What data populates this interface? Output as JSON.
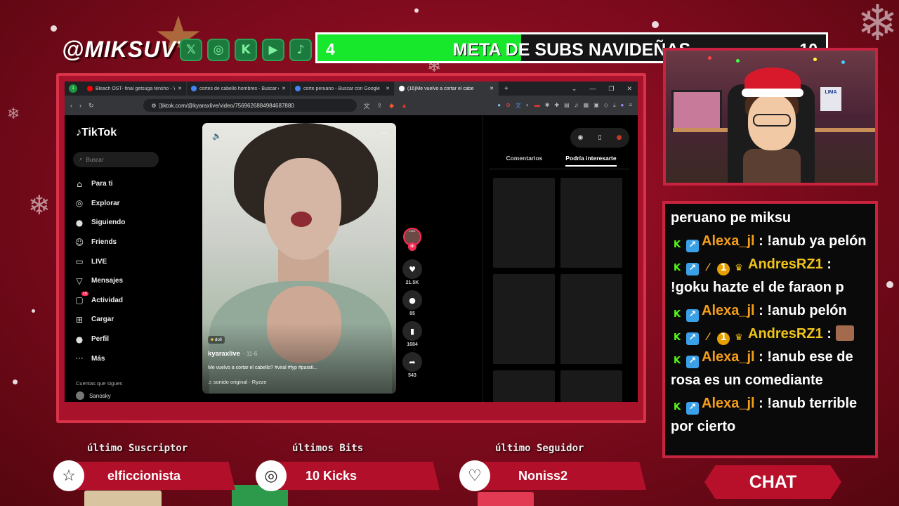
{
  "streamer_handle": "@MIKSUVT",
  "social_icons": [
    "x-icon",
    "instagram-icon",
    "kick-icon",
    "youtube-icon",
    "tiktok-icon"
  ],
  "subs_goal": {
    "current": "4",
    "title": "META DE SUBS NAVIDEÑAS",
    "target": "10",
    "progress_fraction": 0.4
  },
  "browser": {
    "tabs": [
      {
        "title": "Bleach OST- final getsuga tensho - Yo",
        "favicon_color": "#ff0000"
      },
      {
        "title": "cortes de cabello hombres - Buscar c",
        "favicon_color": "#4285f4"
      },
      {
        "title": "corte peruano - Buscar con Google",
        "favicon_color": "#4285f4"
      },
      {
        "title": "(16)Me vuelvo a cortar el cabe",
        "favicon_color": "#ffffff"
      }
    ],
    "active_tab": 3,
    "new_tab": "+",
    "url": "tiktok.com/@kyaraxlive/video/7569626884984687880"
  },
  "tiktok": {
    "logo": "TikTok",
    "search_placeholder": "Buscar",
    "nav": [
      {
        "label": "Para ti",
        "icon": "home-icon",
        "glyph": "⌂"
      },
      {
        "label": "Explorar",
        "icon": "compass-icon",
        "glyph": "◎"
      },
      {
        "label": "Siguiendo",
        "icon": "following-icon",
        "glyph": "●"
      },
      {
        "label": "Friends",
        "icon": "friends-icon",
        "glyph": "☺"
      },
      {
        "label": "LIVE",
        "icon": "live-icon",
        "glyph": "▭"
      },
      {
        "label": "Mensajes",
        "icon": "messages-icon",
        "glyph": "▽"
      },
      {
        "label": "Actividad",
        "icon": "activity-icon",
        "glyph": "▢",
        "badge": "16"
      },
      {
        "label": "Cargar",
        "icon": "upload-icon",
        "glyph": "⊞"
      },
      {
        "label": "Perfil",
        "icon": "profile-icon",
        "glyph": "●"
      },
      {
        "label": "Más",
        "icon": "more-icon",
        "glyph": "···"
      }
    ],
    "following_header": "Cuentas que sigues",
    "following_account": "Sanosky",
    "video": {
      "tag": "doll",
      "username": "kyaraxlive",
      "date": "· 11-6",
      "description": "Me vuelvo a cortar el cabello? #viral #fyp #parati...",
      "sound": "sonido original - Ryzze"
    },
    "live_badge": "LIVE",
    "actions": [
      {
        "icon": "heart-icon",
        "glyph": "♥",
        "count": "21.5K"
      },
      {
        "icon": "comment-icon",
        "glyph": "●",
        "count": "85"
      },
      {
        "icon": "bookmark-icon",
        "glyph": "▮",
        "count": "1684"
      },
      {
        "icon": "share-icon",
        "glyph": "➦",
        "count": "543"
      }
    ],
    "right_tabs": [
      "Comentarios",
      "Podría interesarte"
    ],
    "right_active_tab": 1
  },
  "chat": {
    "messages": [
      {
        "continuation": "peruano pe miksu"
      },
      {
        "user": "Alexa_jl",
        "user_class": "u-alexa",
        "badges": [
          "kick",
          "pin"
        ],
        "text": ": !anub ya pelón"
      },
      {
        "user": "AndresRZ1",
        "user_class": "u-andres",
        "badges": [
          "kick",
          "pin",
          "wand",
          "one",
          "crown"
        ],
        "text": ": !goku hazte el de faraon p"
      },
      {
        "user": "Alexa_jl",
        "user_class": "u-alexa",
        "badges": [
          "kick",
          "pin"
        ],
        "text": ": !anub pelón"
      },
      {
        "user": "AndresRZ1",
        "user_class": "u-andres",
        "badges": [
          "kick",
          "pin",
          "wand",
          "one",
          "crown"
        ],
        "text": ":",
        "emote": true
      },
      {
        "user": "Alexa_jl",
        "user_class": "u-alexa",
        "badges": [
          "kick",
          "pin"
        ],
        "text": ": !anub ese de rosa es un comediante"
      },
      {
        "user": "Alexa_jl",
        "user_class": "u-alexa",
        "badges": [
          "kick",
          "pin"
        ],
        "text": ": !anub terrible por cierto"
      }
    ],
    "button": "CHAT"
  },
  "stats": {
    "last_sub_label": "último Suscriptor",
    "last_sub_value": "elficcionista",
    "last_bits_label": "últimos Bits",
    "last_bits_value": "10 Kicks",
    "last_follower_label": "último Seguidor",
    "last_follower_value": "Noniss2"
  },
  "lima_sign": "LIMA"
}
